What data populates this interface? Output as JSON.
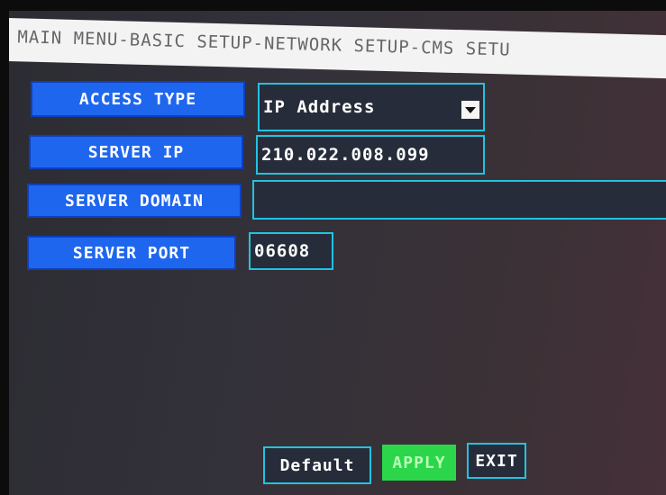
{
  "breadcrumb": "MAIN MENU-BASIC SETUP-NETWORK SETUP-CMS SETU",
  "form": {
    "access_type": {
      "label": "ACCESS TYPE",
      "value": "IP Address"
    },
    "server_ip": {
      "label": "SERVER IP",
      "value": "210.022.008.099"
    },
    "server_domain": {
      "label": "SERVER DOMAIN",
      "value": ""
    },
    "server_port": {
      "label": "SERVER PORT",
      "value": "06608"
    }
  },
  "buttons": {
    "default": "Default",
    "apply": "APPLY",
    "exit": "EXIT"
  },
  "colors": {
    "label_bg": "#1f66ee",
    "field_border": "#21c3e0",
    "apply_bg": "#2bd64a",
    "breadcrumb_bg": "#f3f3f3"
  },
  "icons": {
    "access_type_dropdown": "chevron-down-icon"
  }
}
